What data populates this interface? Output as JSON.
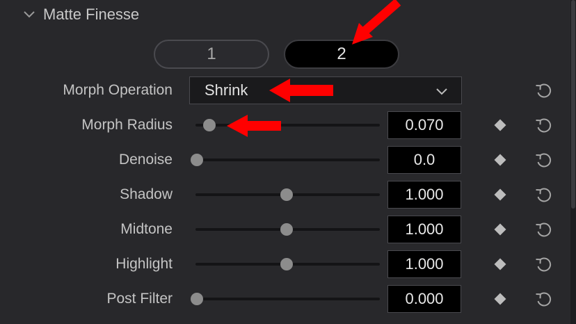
{
  "section": {
    "title": "Matte Finesse",
    "icon": "chevron-down-icon"
  },
  "toggle": {
    "option1": "1",
    "option2": "2",
    "selected": "2"
  },
  "morph_operation": {
    "label": "Morph Operation",
    "value": "Shrink",
    "icon": "chevron-down-icon"
  },
  "sliders": [
    {
      "label": "Morph Radius",
      "value": "0.070",
      "level": 0.07
    },
    {
      "label": "Denoise",
      "value": "0.0",
      "level": 0.0
    },
    {
      "label": "Shadow",
      "value": "1.000",
      "level": 0.5
    },
    {
      "label": "Midtone",
      "value": "1.000",
      "level": 0.5
    },
    {
      "label": "Highlight",
      "value": "1.000",
      "level": 0.5
    },
    {
      "label": "Post Filter",
      "value": "0.000",
      "level": 0.0
    }
  ],
  "icons": {
    "keyframe": "keyframe-diamond-icon",
    "reset": "reset-icon",
    "annotation": "red-arrow-icon"
  },
  "colors": {
    "annotation_arrow": "#ff0000",
    "background": "#28282b"
  }
}
